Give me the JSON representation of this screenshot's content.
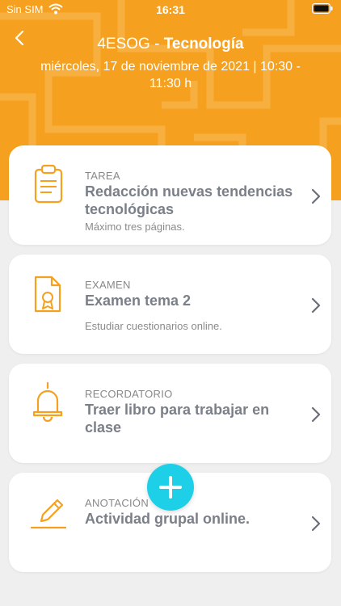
{
  "status_bar": {
    "carrier": "Sin SIM",
    "time": "16:31"
  },
  "header": {
    "course": "4ESOG",
    "separator": " - ",
    "subject": "Tecnología",
    "datetime": "miércoles, 17 de noviembre de 2021 | 10:30 - 11:30 h",
    "background_color": "#f5a11f"
  },
  "cards": [
    {
      "icon": "clipboard-icon",
      "type": "TAREA",
      "title": "Redacción nuevas tendencias tecnológicas",
      "description": "Máximo tres páginas."
    },
    {
      "icon": "certificate-icon",
      "type": "EXAMEN",
      "title": "Examen tema 2",
      "description": "Estudiar cuestionarios online."
    },
    {
      "icon": "bell-icon",
      "type": "RECORDATORIO",
      "title": "Traer libro para trabajar en clase",
      "description": ""
    },
    {
      "icon": "pencil-icon",
      "type": "ANOTACIÓN",
      "title": "Actividad grupal online.",
      "description": ""
    }
  ],
  "fab": {
    "icon": "plus-icon",
    "color": "#1ecfe8"
  },
  "accent_icon_color": "#f5a11f"
}
